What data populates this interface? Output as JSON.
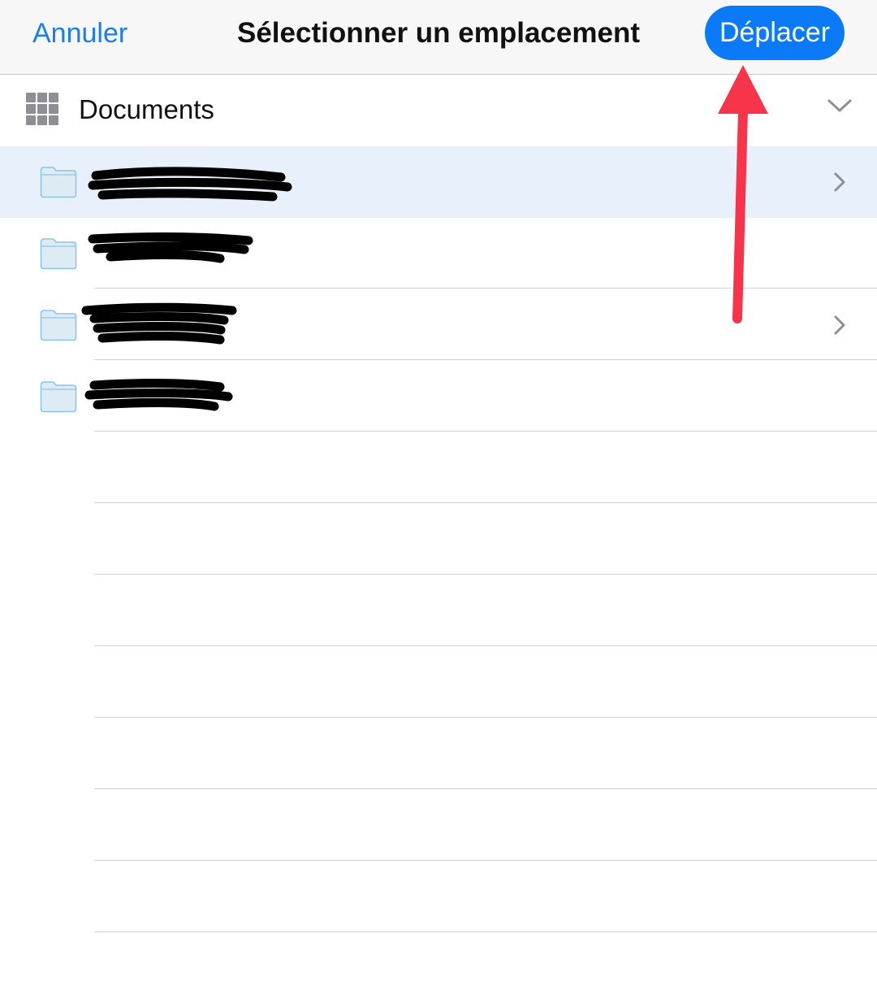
{
  "navbar": {
    "cancel_label": "Annuler",
    "title": "Sélectionner un emplacement",
    "move_label": "Déplacer"
  },
  "location": {
    "icon": "grid-icon",
    "label": "Documents",
    "chevron_icon": "chevron-down-icon"
  },
  "folders": [
    {
      "name": "",
      "selected": true,
      "has_children": true,
      "redacted": true
    },
    {
      "name": "",
      "selected": false,
      "has_children": false,
      "redacted": true
    },
    {
      "name": "",
      "selected": false,
      "has_children": true,
      "redacted": true
    },
    {
      "name": "",
      "selected": false,
      "has_children": false,
      "redacted": true
    }
  ],
  "colors": {
    "accent": "#0a7af6",
    "link": "#1a7df5",
    "selected_row": "#e8f1fb",
    "annotation_arrow": "#f8344a",
    "folder_fill": "#dcebf4",
    "folder_stroke": "#8ec3e8"
  }
}
